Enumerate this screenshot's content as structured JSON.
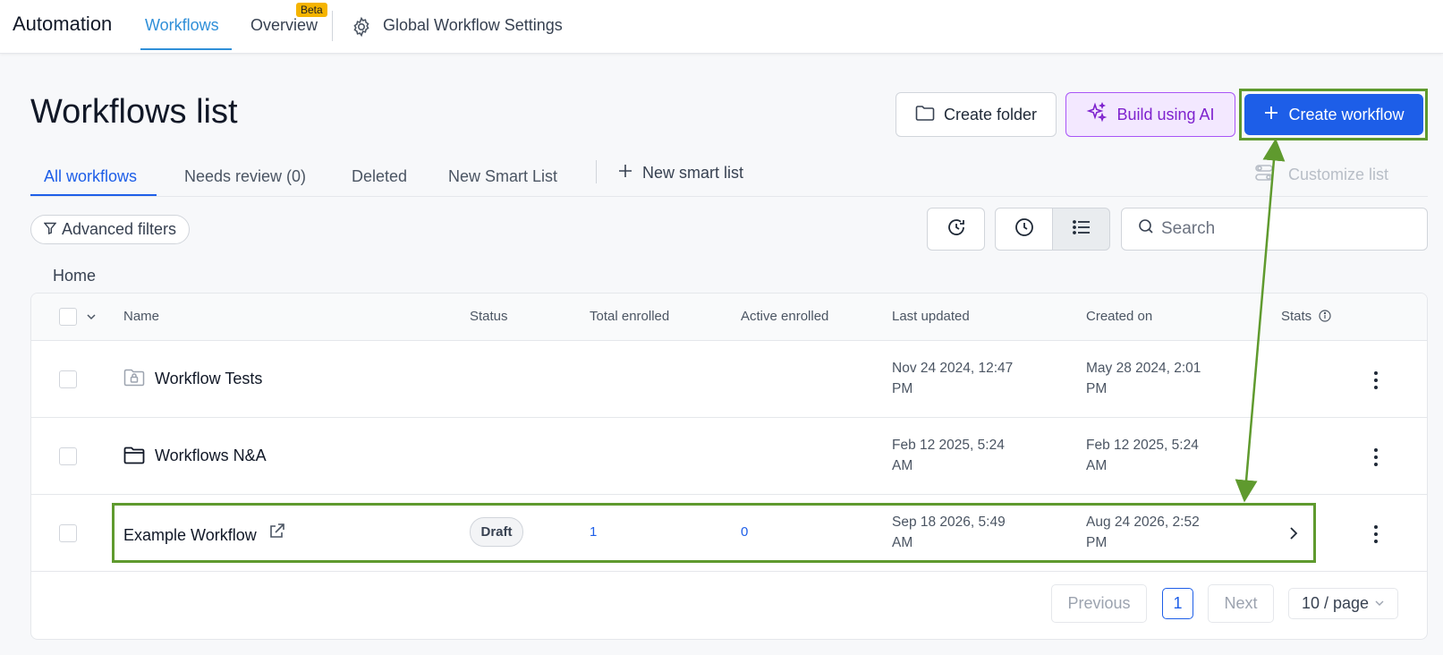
{
  "nav": {
    "app_title": "Automation",
    "tabs": [
      {
        "label": "Workflows"
      },
      {
        "label": "Overview",
        "badge": "Beta"
      }
    ],
    "settings_label": "Global Workflow Settings"
  },
  "header": {
    "title": "Workflows list",
    "create_folder_label": "Create folder",
    "build_ai_label": "Build using AI",
    "create_workflow_label": "Create workflow"
  },
  "list_tabs": [
    {
      "label": "All workflows"
    },
    {
      "label": "Needs review (0)"
    },
    {
      "label": "Deleted"
    },
    {
      "label": "New Smart List"
    }
  ],
  "new_smart_list_label": "New smart list",
  "customize_label": "Customize list",
  "filters": {
    "advanced_label": "Advanced filters",
    "search_placeholder": "Search"
  },
  "breadcrumb": "Home",
  "table": {
    "columns": [
      "Name",
      "Status",
      "Total enrolled",
      "Active enrolled",
      "Last updated",
      "Created on",
      "Stats"
    ],
    "rows": [
      {
        "name": "Workflow Tests",
        "type": "locked-folder",
        "last_updated_1": "Nov 24 2024, 12:47",
        "last_updated_2": "PM",
        "created_1": "May 28 2024, 2:01",
        "created_2": "PM"
      },
      {
        "name": "Workflows N&A",
        "type": "folder",
        "last_updated_1": "Feb 12 2025, 5:24",
        "last_updated_2": "AM",
        "created_1": "Feb 12 2025, 5:24",
        "created_2": "AM"
      },
      {
        "name": "Example Workflow",
        "type": "workflow",
        "status": "Draft",
        "total_enrolled": "1",
        "active_enrolled": "0",
        "last_updated_1": "Sep 18 2026, 5:49",
        "last_updated_2": "AM",
        "created_1": "Aug 24 2026, 2:52",
        "created_2": "PM"
      }
    ]
  },
  "pagination": {
    "previous_label": "Previous",
    "current_page": "1",
    "next_label": "Next",
    "page_size": "10 / page"
  },
  "colors": {
    "primary": "#1d5ee8",
    "ai_purple": "#7e22ce",
    "annotation_green": "#5f9a2e",
    "nav_active": "#2f8fd8"
  }
}
